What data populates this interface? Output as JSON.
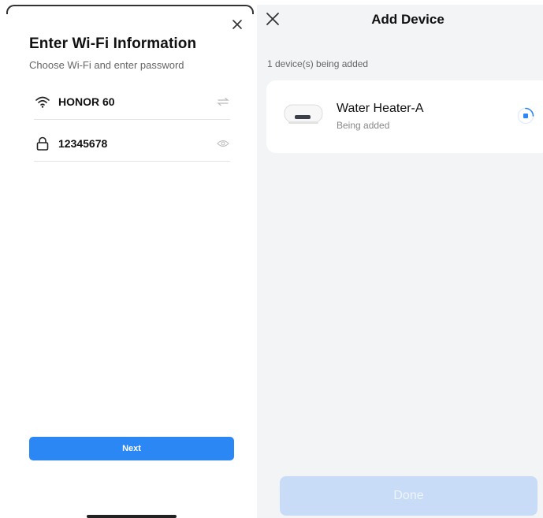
{
  "left": {
    "title": "Enter Wi-Fi Information",
    "subtitle": "Choose Wi-Fi and enter password",
    "wifi_name": "HONOR 60",
    "password": "12345678",
    "next_label": "Next"
  },
  "right": {
    "title": "Add Device",
    "status": "1 device(s) being added",
    "device": {
      "name": "Water Heater-A",
      "status": "Being added"
    },
    "done_label": "Done"
  },
  "colors": {
    "accent": "#2a87f3",
    "done_disabled": "#c9dcf7",
    "panel_bg": "#f3f4f6"
  },
  "icons": {
    "close": "close-icon",
    "wifi": "wifi-icon",
    "swap": "swap-icon",
    "lock": "lock-icon",
    "eye": "eye-icon",
    "spinner": "loading-spinner-icon"
  }
}
